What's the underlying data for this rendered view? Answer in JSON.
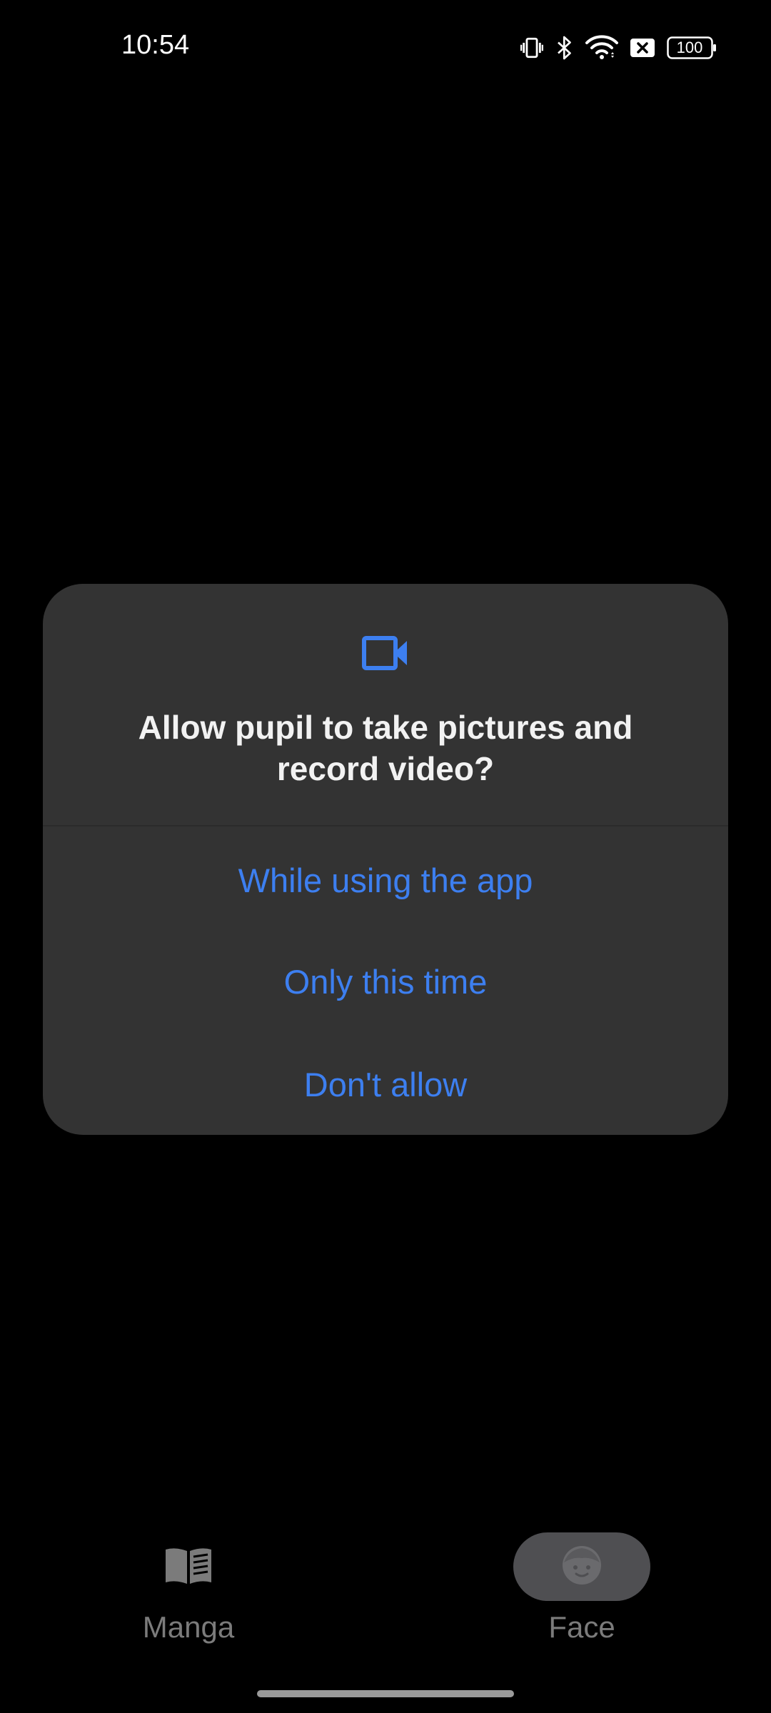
{
  "status_bar": {
    "time": "10:54",
    "battery_level": "100",
    "icons": [
      "vibrate-icon",
      "bluetooth-icon",
      "wifi-icon",
      "no-sim-icon",
      "battery-icon"
    ]
  },
  "dialog": {
    "icon": "videocam-icon",
    "title": "Allow pupil to take pictures and record video?",
    "buttons": {
      "while_using": "While using the app",
      "only_this_time": "Only this time",
      "dont_allow": "Don't allow"
    }
  },
  "bottom_nav": {
    "items": [
      {
        "label": "Manga",
        "icon": "book-icon",
        "selected": false
      },
      {
        "label": "Face",
        "icon": "face-icon",
        "selected": true
      }
    ]
  },
  "colors": {
    "background": "#000000",
    "dialog_background": "#333333",
    "accent": "#3d7ff0",
    "nav_inactive": "#7b7b7b",
    "nav_selected_pill": "#4f4f52"
  }
}
